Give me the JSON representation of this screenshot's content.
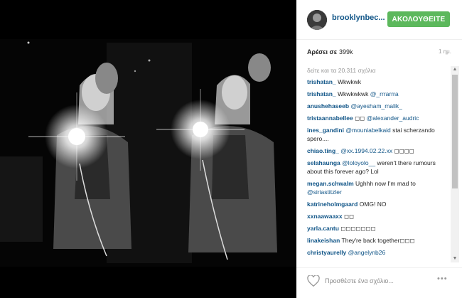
{
  "post": {
    "username": "brooklynbec...",
    "follow_label": "ΑΚΟΛΟΥΘΕΙΤΕ",
    "likes_label": "Αρέσει σε",
    "likes_count": "399k",
    "time": "1 ημ.",
    "view_all": "δείτε και τα 20.311 σχόλια"
  },
  "comments": [
    {
      "user": "trishatan_",
      "text": " Wkwkwk",
      "mention": ""
    },
    {
      "user": "trishatan_",
      "text": " Wkwkwkwk ",
      "mention": "@_rrrarrra"
    },
    {
      "user": "anushehaseeb",
      "text": " ",
      "mention": "@ayesham_malik_"
    },
    {
      "user": "tristaannabellee",
      "text": " ◻◻ ",
      "mention": "@alexander_audric"
    },
    {
      "user": "ines_gandini",
      "text": " ",
      "mention": "@mouniabelkaid",
      "after": " stai scherzando spero...."
    },
    {
      "user": "chiao.ting_",
      "text": " ",
      "mention": "@xx.1994.02.22.xx",
      "after": " ◻◻◻◻"
    },
    {
      "user": "selahaunga",
      "text": " ",
      "mention": "@loloyolo__",
      "after": " weren't there rumours about this forever ago? Lol"
    },
    {
      "user": "megan.schwalm",
      "text": " Ughhh now I'm mad to ",
      "mention": "@siriastitzler"
    },
    {
      "user": "katrineholmgaard",
      "text": " OMG! NO",
      "mention": ""
    },
    {
      "user": "xxnaawaaxx",
      "text": " ◻◻",
      "mention": ""
    },
    {
      "user": "yarla.cantu",
      "text": " ◻◻◻◻◻◻◻",
      "mention": ""
    },
    {
      "user": "linakeishan",
      "text": " They're back together◻◻◻",
      "mention": ""
    },
    {
      "user": "christyaurelly",
      "text": " ",
      "mention": "@angelynb26"
    }
  ],
  "footer": {
    "add_comment_placeholder": "Προσθέστε ένα σχόλιο...",
    "more_label": "•••"
  },
  "colors": {
    "follow_button": "#5cb85c",
    "username_link": "#125688"
  }
}
